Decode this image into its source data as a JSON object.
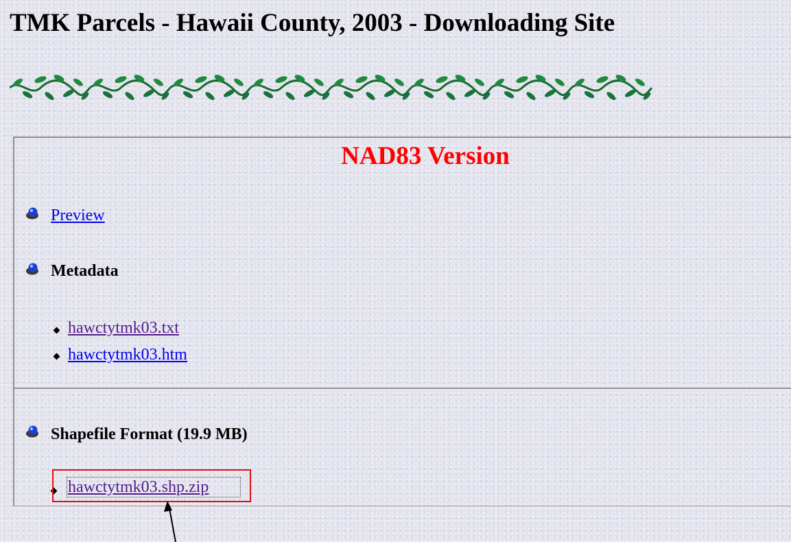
{
  "page": {
    "title": "TMK Parcels - Hawaii County, 2003 - Downloading Site"
  },
  "decoration": {
    "vine": "vine-divider-icon"
  },
  "section": {
    "title": "NAD83 Version",
    "title_color": "#ff0000"
  },
  "items": {
    "preview": {
      "label": "Preview",
      "icon": "blue-ball-bullet-icon"
    },
    "metadata": {
      "label": "Metadata",
      "icon": "blue-ball-bullet-icon",
      "files": [
        "hawctytmk03.txt",
        "hawctytmk03.htm"
      ]
    },
    "shapefile": {
      "label": "Shapefile Format (19.9 MB)",
      "icon": "blue-ball-bullet-icon",
      "files": [
        "hawctytmk03.shp.zip"
      ]
    }
  },
  "annotation": {
    "highlight_color": "#e01010",
    "pointer": "arrow-pointer-icon"
  },
  "colors": {
    "link": "#0000ee",
    "visited_link": "#551a8b",
    "background": "#e4e4ee"
  }
}
